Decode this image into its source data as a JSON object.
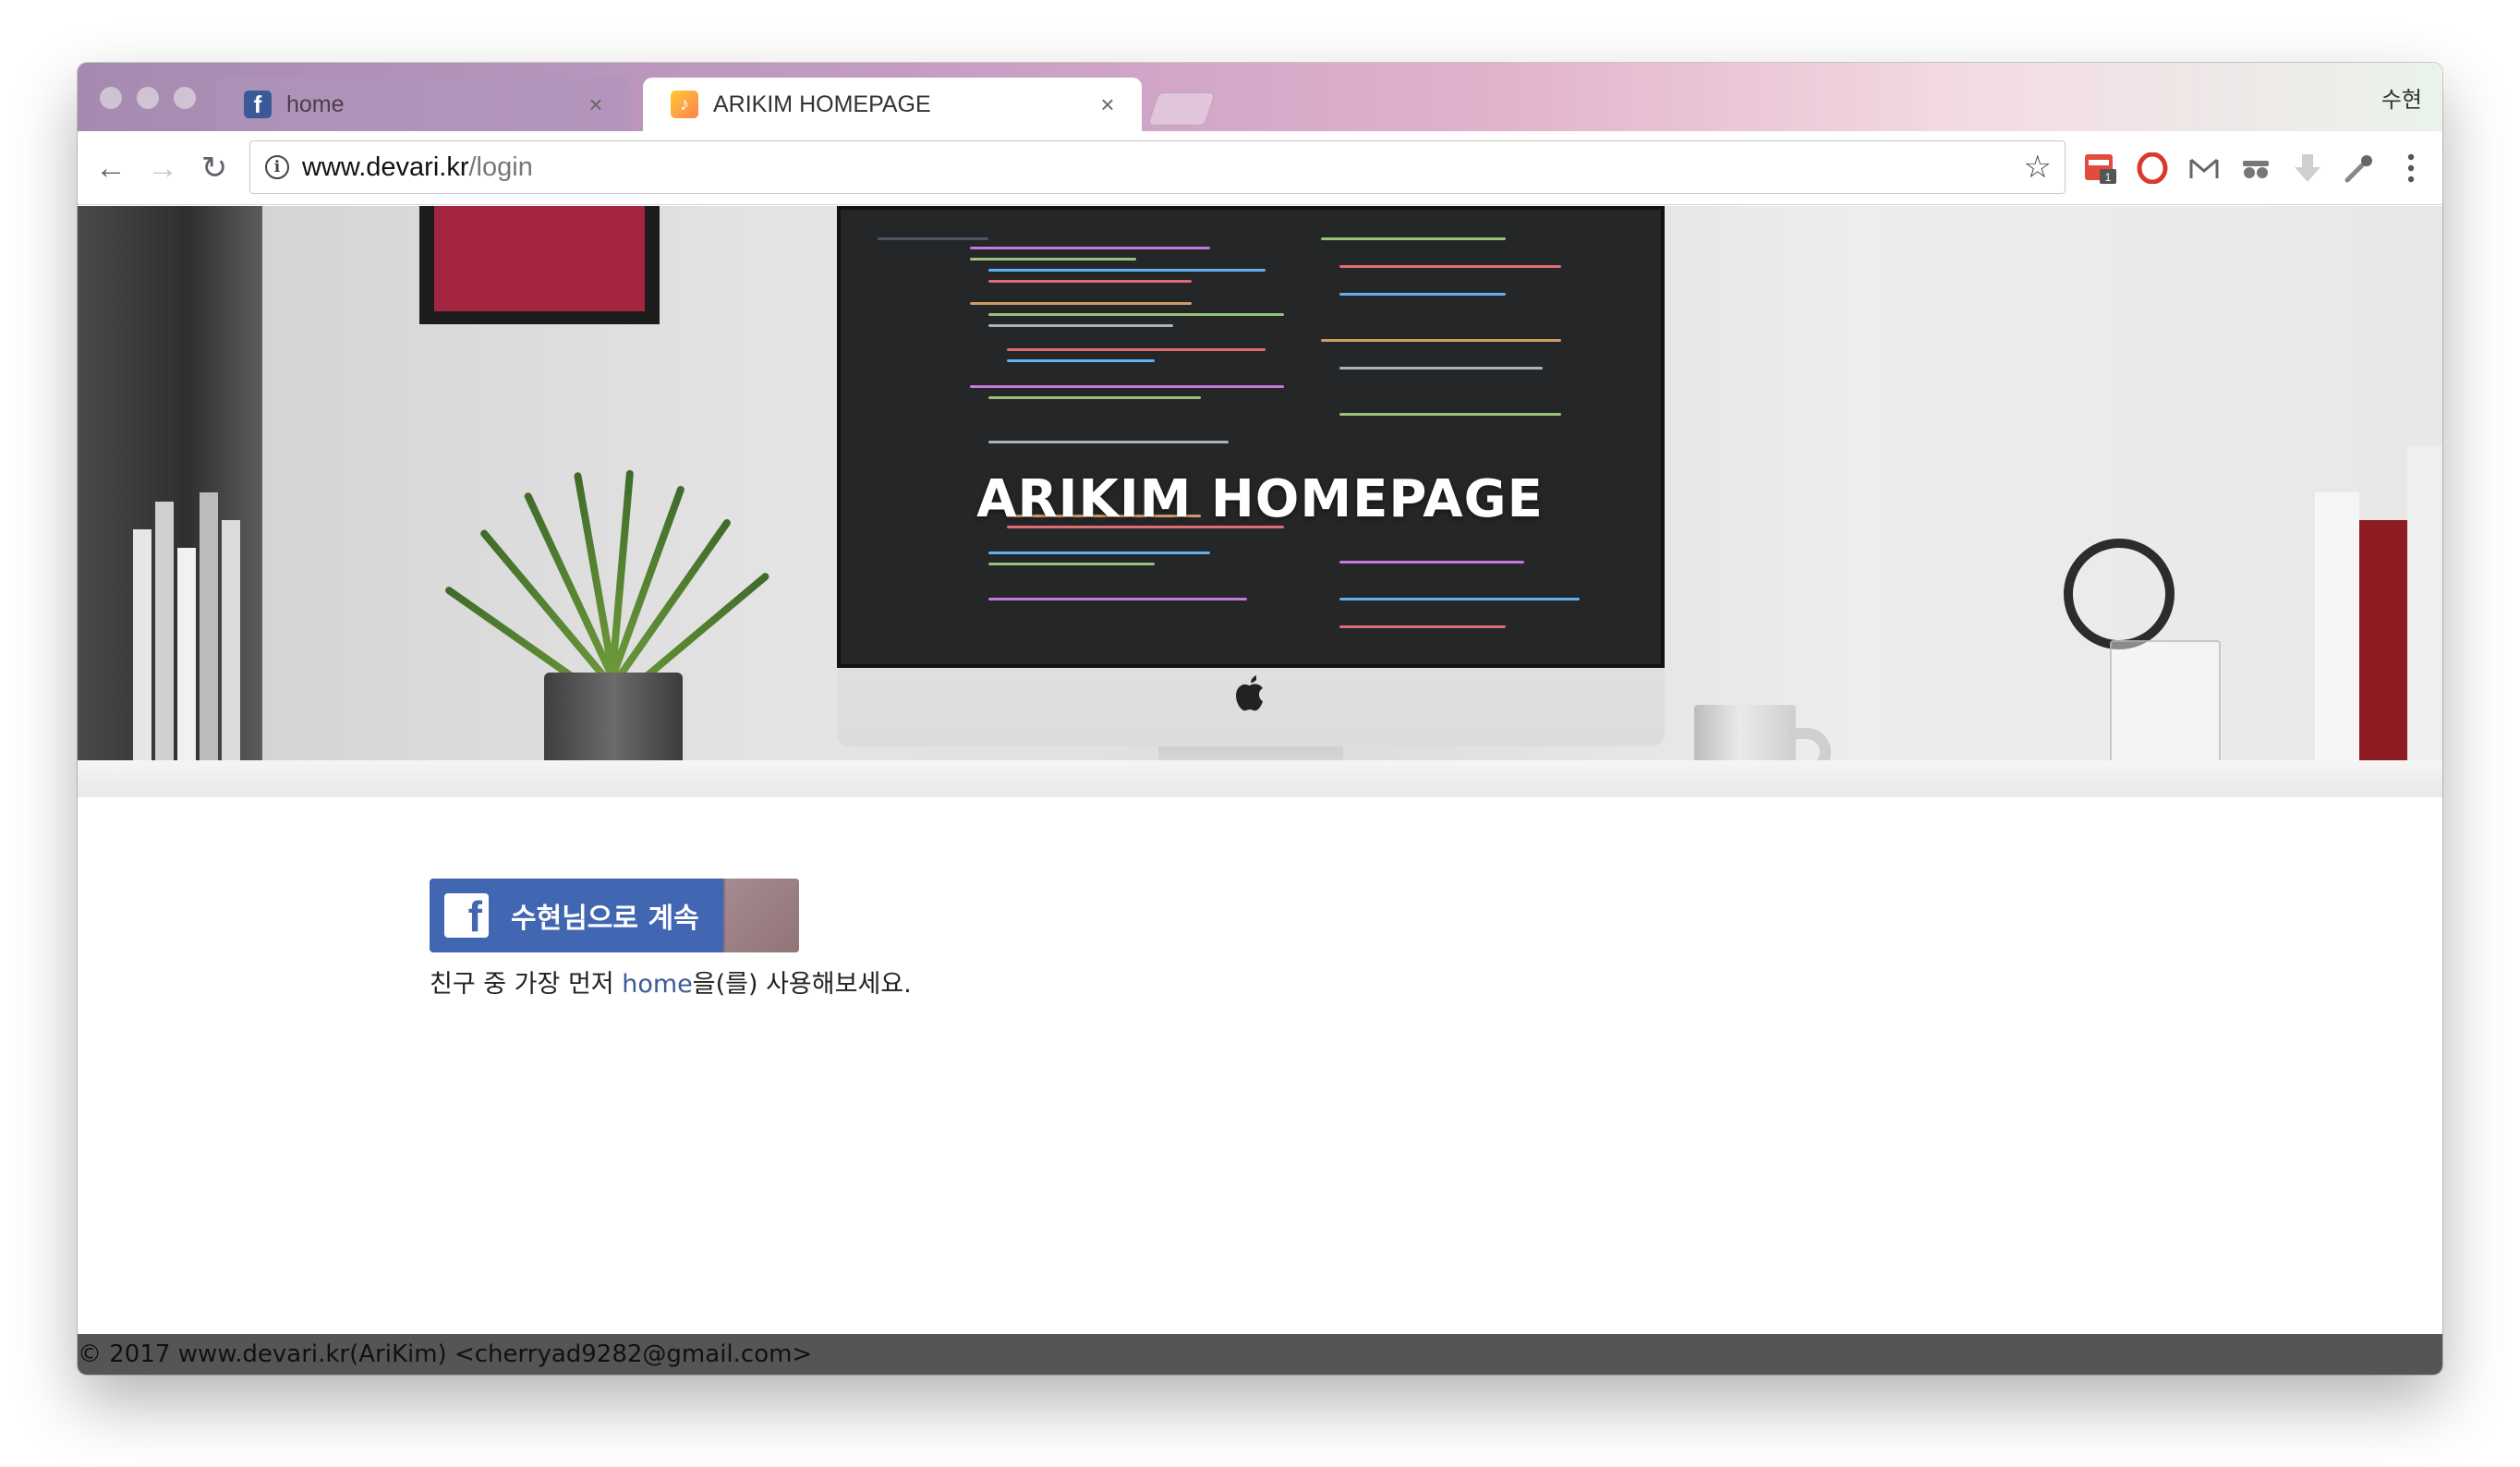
{
  "browser": {
    "tabs": [
      {
        "title": "home",
        "icon": "facebook-icon",
        "active": false
      },
      {
        "title": "ARIKIM HOMEPAGE",
        "icon": "music-note-icon",
        "active": true
      }
    ],
    "profile_name": "수현",
    "url_host": "www.devari.kr",
    "url_path": "/login",
    "close_glyph": "×"
  },
  "hero": {
    "title": "ARIKIM HOMEPAGE"
  },
  "login": {
    "button_label": "수현님으로 계속",
    "friends_prefix": "친구 중 가장 먼저 ",
    "friends_app": "home",
    "friends_suffix": "을(를) 사용해보세요."
  },
  "footer": {
    "text": "© 2017 www.devari.kr(AriKim) <cherryad9282@gmail.com>"
  },
  "colors": {
    "facebook_blue": "#4267b2",
    "footer_bg": "#555555",
    "link": "#3b5998"
  }
}
